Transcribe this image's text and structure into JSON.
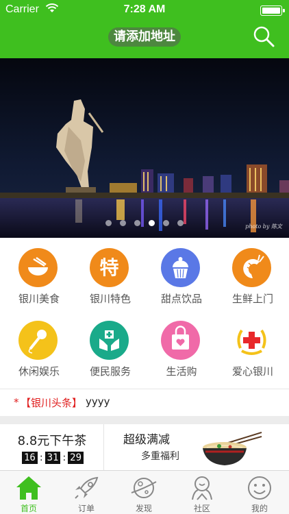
{
  "status_bar": {
    "carrier": "Carrier",
    "time": "7:28 AM"
  },
  "header": {
    "address_placeholder": "请添加地址",
    "search_icon": "search-icon",
    "color": "#3fbf1f"
  },
  "banner": {
    "slide_count": 8,
    "active_slide": 5,
    "watermark": "photo by 陈文"
  },
  "categories": [
    {
      "label": "银川美食",
      "icon": "bowl-icon",
      "color": "#f08a1a"
    },
    {
      "label": "银川特色",
      "icon": "te-character-icon",
      "color": "#f08a1a"
    },
    {
      "label": "甜点饮品",
      "icon": "cupcake-icon",
      "color": "#5a78e6"
    },
    {
      "label": "生鲜上门",
      "icon": "shrimp-icon",
      "color": "#f08a1a"
    },
    {
      "label": "休闲娱乐",
      "icon": "microphone-icon",
      "color": "#f4c21a"
    },
    {
      "label": "便民服务",
      "icon": "hands-icon",
      "color": "#1aaa8a"
    },
    {
      "label": "生活购",
      "icon": "shopping-bag-icon",
      "color": "#f06aa8"
    },
    {
      "label": "爱心银川",
      "icon": "red-cross-icon",
      "color": "#e8282a"
    }
  ],
  "headline": {
    "marker": "*",
    "tag": "【银川头条】",
    "text": "yyyy"
  },
  "promo": {
    "afternoon_tea": {
      "title": "8.8元下午茶",
      "countdown": [
        "16",
        "31",
        "29"
      ]
    },
    "discount": {
      "title": "超级满减",
      "subtitle": "多重福利"
    }
  },
  "tabbar": [
    {
      "label": "首页",
      "icon": "home-icon",
      "active": true
    },
    {
      "label": "订单",
      "icon": "rocket-icon",
      "active": false
    },
    {
      "label": "发现",
      "icon": "planet-icon",
      "active": false
    },
    {
      "label": "社区",
      "icon": "person-icon",
      "active": false
    },
    {
      "label": "我的",
      "icon": "smiley-icon",
      "active": false
    }
  ]
}
